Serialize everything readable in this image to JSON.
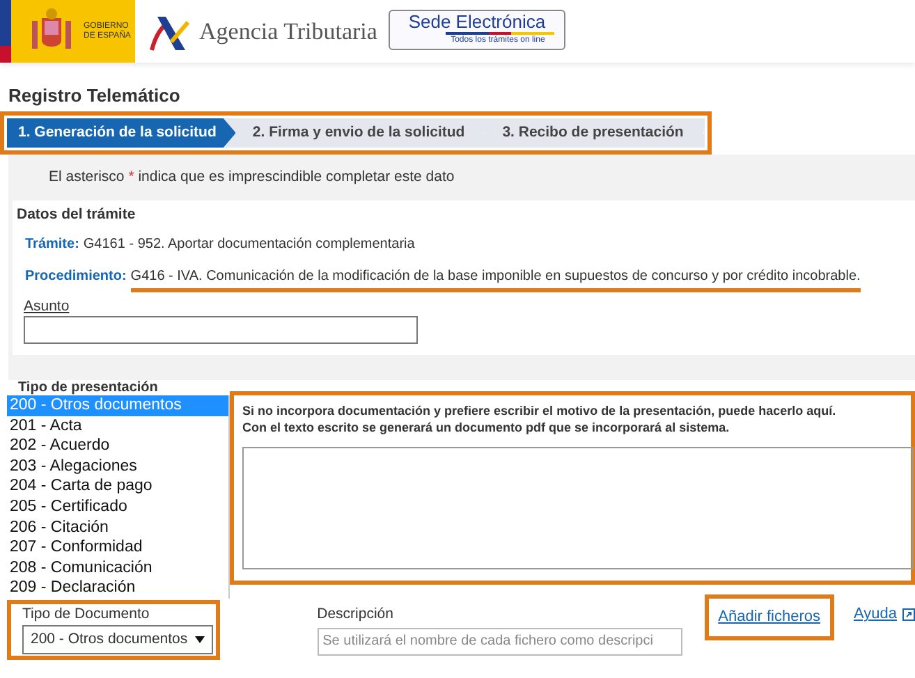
{
  "header": {
    "government": [
      "GOBIERNO",
      "DE ESPAÑA"
    ],
    "agency": "Agencia Tributaria",
    "sede": {
      "title": "Sede Electrónica",
      "tagline": "Todos los trámites on line"
    }
  },
  "page_title": "Registro Telemático",
  "steps": {
    "highlighted": true,
    "items": [
      {
        "label": "1. Generación de la solicitud",
        "selected": true
      },
      {
        "label": "2. Firma y envio de la solicitud",
        "selected": false
      },
      {
        "label": "3. Recibo de presentación",
        "selected": false
      }
    ]
  },
  "notice": {
    "before": "El asterisco",
    "asterisk": "*",
    "after": "indica que es imprescindible completar este dato"
  },
  "details": {
    "title": "Datos del trámite",
    "fields": [
      {
        "label": "Trámite:",
        "value": "G4161 - 952. Aportar documentación complementaria",
        "highlighted": false
      },
      {
        "label": "Procedimiento:",
        "value": "G416 - IVA. Comunicación de la modificación de la base imponible en supuestos de concurso y por crédito incobrable.",
        "highlighted": true
      }
    ],
    "subject_label": "Asunto"
  },
  "presentation": {
    "label": "Tipo de presentación",
    "options": [
      {
        "label": "200 - Otros documentos",
        "selected": true
      },
      {
        "label": "201 - Acta",
        "selected": false
      },
      {
        "label": "202 - Acuerdo",
        "selected": false
      },
      {
        "label": "203 - Alegaciones",
        "selected": false
      },
      {
        "label": "204 - Carta de pago",
        "selected": false
      },
      {
        "label": "205 - Certificado",
        "selected": false
      },
      {
        "label": "206 - Citación",
        "selected": false
      },
      {
        "label": "207 - Conformidad",
        "selected": false
      },
      {
        "label": "208 - Comunicación",
        "selected": false
      },
      {
        "label": "209 - Declaración",
        "selected": false
      }
    ],
    "note": [
      "Si no incorpora documentación y prefiere escribir el motivo de la presentación, puede hacerlo aquí.",
      "Con el texto escrito se generará un documento pdf que se incorporará al sistema."
    ],
    "note_highlighted": true
  },
  "files": {
    "document_type": {
      "label": "Tipo de Documento",
      "value": "200 - Otros documentos",
      "highlighted": true
    },
    "description": {
      "label": "Descripción",
      "placeholder": "Se utilizará el nombre de cada fichero como descripci"
    },
    "add_link": {
      "label": "Añadir ficheros",
      "highlighted": true
    },
    "help_link": "Ayuda"
  }
}
